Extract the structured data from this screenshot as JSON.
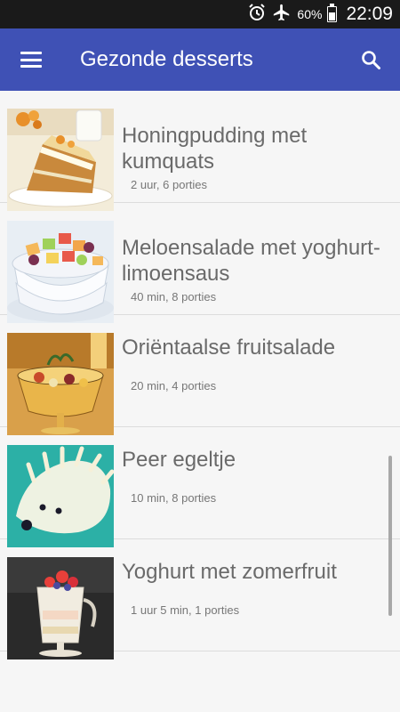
{
  "status_bar": {
    "alarm_icon": "alarm-clock-icon",
    "airplane_icon": "airplane-mode-icon",
    "battery_percent": "60%",
    "battery_icon": "battery-icon",
    "time": "22:09"
  },
  "app_bar": {
    "menu_icon": "hamburger-menu-icon",
    "title": "Gezonde desserts",
    "search_icon": "search-icon",
    "color": "#3f51b5"
  },
  "recipes": [
    {
      "title": "Honingpudding met kumquats",
      "meta": "2 uur, 6 porties",
      "image": "honey-pudding-photo"
    },
    {
      "title": "Meloensalade met yoghurt-limoensaus",
      "meta": "40 min, 8 porties",
      "image": "melon-salad-photo"
    },
    {
      "title": "Oriëntaalse fruitsalade",
      "meta": "20 min, 4 porties",
      "image": "fruit-salad-photo"
    },
    {
      "title": "Peer egeltje",
      "meta": "10 min, 8 porties",
      "image": "pear-hedgehog-photo"
    },
    {
      "title": "Yoghurt met zomerfruit",
      "meta": "1 uur 5 min, 1 porties",
      "image": "yoghurt-fruit-photo"
    }
  ]
}
